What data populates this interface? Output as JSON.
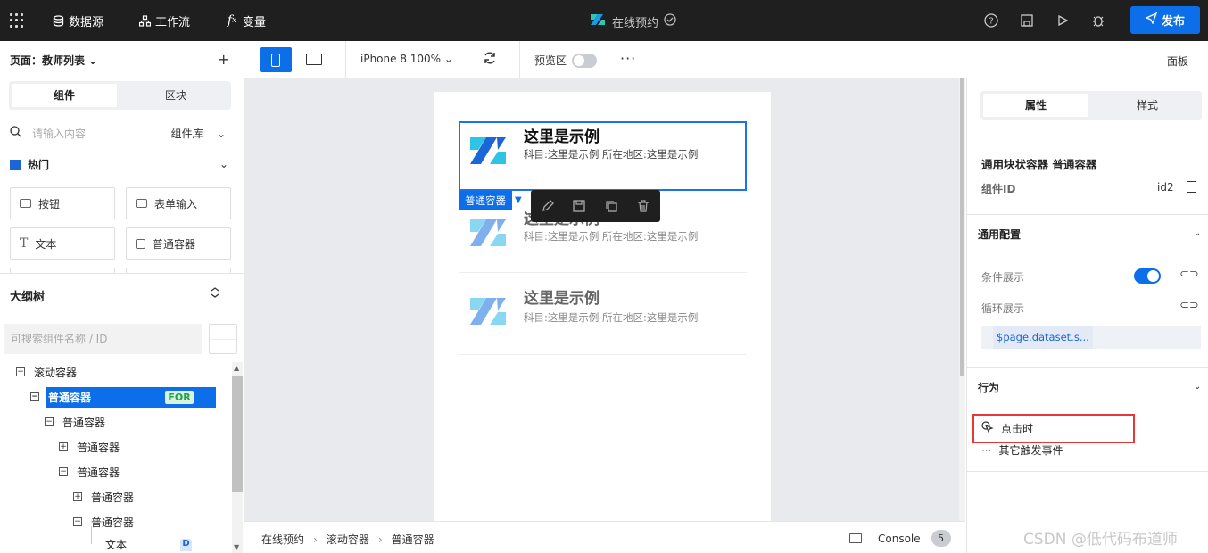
{
  "topbar": {
    "datasource": "数据源",
    "workflow": "工作流",
    "variables": "变量",
    "app_title": "在线预约",
    "publish": "发布"
  },
  "left": {
    "page_label": "页面：教师列表",
    "tabs": [
      "组件",
      "区块"
    ],
    "search_placeholder": "请输入内容",
    "library": "组件库",
    "hot_group": "热门",
    "components": [
      "按钮",
      "表单输入",
      "文本",
      "普通容器"
    ],
    "outline_title": "大纲树",
    "outline_search": "可搜索组件名称 / ID",
    "tree": [
      {
        "label": "滚动容器"
      },
      {
        "label": "普通容器",
        "badge": "FOR"
      },
      {
        "label": "普通容器"
      },
      {
        "label": "普通容器"
      },
      {
        "label": "普通容器"
      },
      {
        "label": "普通容器"
      },
      {
        "label": "普通容器"
      },
      {
        "label": "文本"
      }
    ]
  },
  "toolbar": {
    "device": "iPhone 8 100%",
    "preview": "预览区",
    "more": "···",
    "panel": "面板"
  },
  "canvas": {
    "cards": [
      {
        "title": "这里是示例",
        "subtitle": "科目:这里是示例 所在地区:这里是示例"
      },
      {
        "title": "这里是示例",
        "subtitle": "科目:这里是示例 所在地区:这里是示例"
      },
      {
        "title": "这里是示例",
        "subtitle": "科目:这里是示例 所在地区:这里是示例"
      }
    ],
    "selected_tag": "普通容器"
  },
  "breadcrumb": {
    "items": [
      "在线预约",
      "滚动容器",
      "普通容器"
    ],
    "console": "Console",
    "console_count": "5"
  },
  "right": {
    "tabs": [
      "属性",
      "样式"
    ],
    "component_title": "通用块状容器 普通容器",
    "id_label": "组件ID",
    "id_value": "id2",
    "general": "通用配置",
    "conditional": "条件展示",
    "loop": "循环展示",
    "dataset": "$page.dataset.s...",
    "behavior": "行为",
    "on_click": "点击时",
    "other_events": "其它触发事件"
  },
  "watermark": "CSDN @低代码布道师",
  "colors": {
    "accent": "#0d6ee9",
    "topbar": "#1f1f1f",
    "highlight": "#e53935"
  }
}
